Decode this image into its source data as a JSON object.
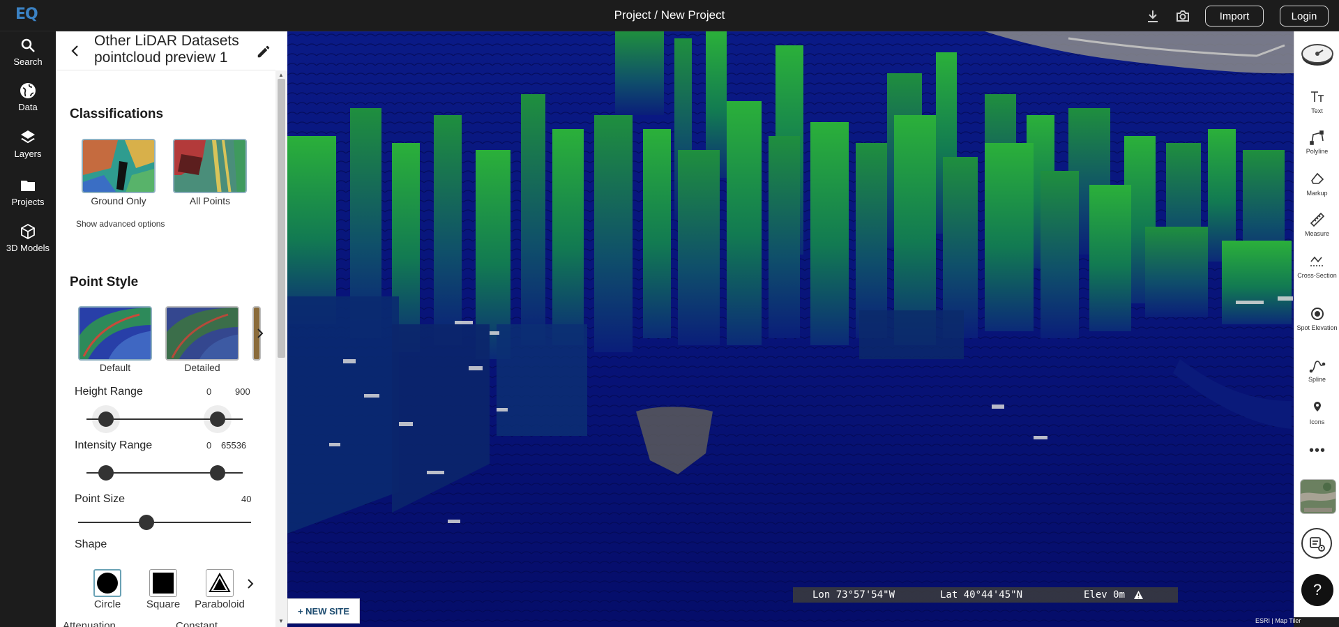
{
  "topbar": {
    "logo": "EQ",
    "title": "Project / New Project",
    "download_icon": "download-icon",
    "camera_icon": "camera-icon",
    "import_label": "Import",
    "login_label": "Login"
  },
  "leftnav": {
    "items": [
      {
        "label": "Search",
        "icon": "search-icon"
      },
      {
        "label": "Data",
        "icon": "globe-icon"
      },
      {
        "label": "Layers",
        "icon": "layers-icon"
      },
      {
        "label": "Projects",
        "icon": "folder-icon"
      },
      {
        "label": "3D Models",
        "icon": "cube-icon"
      }
    ]
  },
  "panel": {
    "title": "Other LiDAR Datasets pointcloud preview 1",
    "classifications": {
      "heading": "Classifications",
      "options": [
        "Ground Only",
        "All Points"
      ],
      "advanced": "Show advanced options"
    },
    "point_style": {
      "heading": "Point Style",
      "options": [
        "Default",
        "Detailed"
      ],
      "height_range": {
        "label": "Height Range",
        "min": "0",
        "max": "900"
      },
      "intensity_range": {
        "label": "Intensity Range",
        "min": "0",
        "max": "65536"
      },
      "point_size": {
        "label": "Point Size",
        "value": "40"
      },
      "shape": {
        "label": "Shape",
        "options": [
          "Circle",
          "Square",
          "Paraboloid"
        ]
      },
      "cut_labels": [
        "Attenuation",
        "Constant"
      ]
    }
  },
  "viewport": {
    "new_site": "+ NEW SITE",
    "lon": "Lon 73°57'54\"W",
    "lat": "Lat 40°44'45\"N",
    "elev": "Elev 0m",
    "attribution": "ESRI | Map Tiler"
  },
  "righttools": {
    "tools": [
      {
        "label": "Text",
        "icon": "text-icon"
      },
      {
        "label": "Polyline",
        "icon": "polyline-icon"
      },
      {
        "label": "Markup",
        "icon": "markup-icon"
      },
      {
        "label": "Measure",
        "icon": "ruler-icon"
      },
      {
        "label": "Cross-Section",
        "icon": "cross-section-icon"
      },
      {
        "label": "Spot Elevation",
        "icon": "spot-elevation-icon"
      },
      {
        "label": "Spline",
        "icon": "spline-icon"
      },
      {
        "label": "Icons",
        "icon": "pin-icon"
      }
    ],
    "more": "•••",
    "help": "?"
  },
  "colors": {
    "bar_bg": "#1c1c1c",
    "accent": "#3b82c4",
    "viewport_bg": "#06107a"
  }
}
